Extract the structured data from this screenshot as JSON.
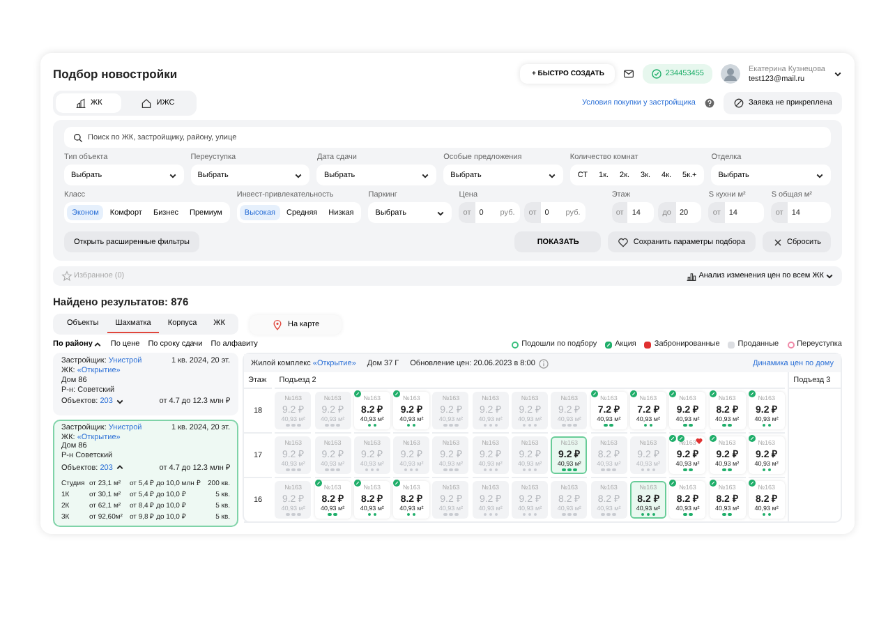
{
  "header": {
    "title": "Подбор новостройки",
    "quick_create": "+ БЫСТРО СОЗДАТЬ",
    "balance": "234453455",
    "user": {
      "name": "Екатерина Кузнецова",
      "email": "test123@mail.ru"
    }
  },
  "object_tabs": [
    {
      "label": "ЖК",
      "kind": "complex",
      "selected": true
    },
    {
      "label": "ИЖС",
      "kind": "house",
      "selected": false
    }
  ],
  "purchase_terms_link": "Условия покупки у застройщика",
  "request_button": "Заявка не прикреплена",
  "filters": {
    "search": {
      "placeholder": "Поиск по ЖК, застройщику, району, улице"
    },
    "primary": [
      {
        "kind": "select",
        "label": "Тип объекта",
        "value": "Выбрать"
      },
      {
        "kind": "select",
        "label": "Переуступка",
        "value": "Выбрать"
      },
      {
        "kind": "select",
        "label": "Дата сдачи",
        "value": "Выбрать"
      },
      {
        "kind": "select",
        "label": "Особые предложения",
        "value": "Выбрать"
      },
      {
        "kind": "chips",
        "label": "Количество комнат",
        "options": [
          {
            "label": "СТ",
            "selected": false
          },
          {
            "label": "1к.",
            "selected": false
          },
          {
            "label": "2к.",
            "selected": false
          },
          {
            "label": "3к.",
            "selected": false
          },
          {
            "label": "4к.",
            "selected": false
          },
          {
            "label": "5к.+",
            "selected": false
          }
        ]
      },
      {
        "kind": "select",
        "label": "Отделка",
        "value": "Выбрать"
      }
    ],
    "secondary": [
      {
        "kind": "chips",
        "label": "Класс",
        "options": [
          {
            "label": "Эконом",
            "selected": true
          },
          {
            "label": "Комфорт",
            "selected": false
          },
          {
            "label": "Бизнес",
            "selected": false
          },
          {
            "label": "Премиум",
            "selected": false
          }
        ]
      },
      {
        "kind": "chips",
        "label": "Инвест-привлекательность",
        "options": [
          {
            "label": "Высокая",
            "selected": true
          },
          {
            "label": "Средняя",
            "selected": false
          },
          {
            "label": "Низкая",
            "selected": false
          }
        ]
      },
      {
        "kind": "select",
        "label": "Паркинг",
        "value": "Выбрать"
      },
      {
        "kind": "range",
        "label": "Цена",
        "inputs": [
          {
            "prefix": "от",
            "value": "0",
            "suffix": "руб."
          },
          {
            "prefix": "от",
            "value": "0",
            "suffix": "руб."
          }
        ]
      },
      {
        "kind": "range",
        "label": "Этаж",
        "inputs": [
          {
            "prefix": "от",
            "value": "14"
          },
          {
            "prefix": "до",
            "value": "20"
          }
        ]
      },
      {
        "kind": "range",
        "label": "S кухни м²",
        "inputs": [
          {
            "prefix": "от",
            "value": "14"
          }
        ]
      },
      {
        "kind": "range",
        "label": "S общая м²",
        "inputs": [
          {
            "prefix": "от",
            "value": "14"
          }
        ]
      }
    ],
    "advanced_button": "Открыть расширенные фильтры",
    "show_button": "ПОКАЗАТЬ",
    "save_button": "Сохранить параметры подбора",
    "reset_button": "Сбросить"
  },
  "favorites": {
    "label": "Избранное (0)",
    "disabled": true
  },
  "price_analysis": "Анализ изменения цен по всем ЖК",
  "results_title": "Найдено результатов: 876",
  "view_tabs": [
    {
      "label": "Объекты",
      "selected": false
    },
    {
      "label": "Шахматка",
      "selected": true
    },
    {
      "label": "Корпуса",
      "selected": false
    },
    {
      "label": "ЖК",
      "selected": false
    }
  ],
  "map_button": "На карте",
  "sort_options": [
    {
      "label": "По району",
      "selected": true
    },
    {
      "label": "По цене",
      "selected": false
    },
    {
      "label": "По сроку сдачи",
      "selected": false
    },
    {
      "label": "По алфавиту",
      "selected": false
    }
  ],
  "legend": [
    {
      "label": "Подошли по подбору",
      "kind": "outline",
      "color": "#3cc07f"
    },
    {
      "label": "Акция",
      "kind": "promo",
      "color": "#1fae6a"
    },
    {
      "label": "Забронированные",
      "kind": "filled",
      "color": "#e03030"
    },
    {
      "label": "Проданные",
      "kind": "filled",
      "color": "#dcdee2"
    },
    {
      "label": "Переуступка",
      "kind": "outline",
      "color": "#f08aa8"
    }
  ],
  "complexes": [
    {
      "developer_label": "Застройщик:",
      "developer": "Унистрой",
      "deadline": "1 кв. 2024, 20 эт.",
      "complex_label": "ЖК:",
      "complex": "«Открытие»",
      "house": "Дом 86",
      "district": "Р-н: Советский",
      "objects_label": "Объектов:",
      "objects": "203",
      "price_range": "от 4.7 до 12.3 млн ₽",
      "expanded": false,
      "selected": false
    },
    {
      "developer_label": "Застройщик:",
      "developer": "Унистрой",
      "deadline": "1 кв. 2024, 20 эт.",
      "complex_label": "ЖК:",
      "complex": "«Открытие»",
      "house": "Дом 86",
      "district": "Р-н Советский",
      "objects_label": "Объектов:",
      "objects": "203",
      "price_range": "от 4.7 до 12.3 млн ₽",
      "expanded": true,
      "selected": true,
      "layouts": [
        {
          "type": "Студия",
          "area": "от 23,1 м²",
          "price": "от 5,4 ₽ до 10,0 млн ₽",
          "count": "200 кв."
        },
        {
          "type": "1К",
          "area": "от 30,1 м²",
          "price": "от 5,4 ₽ до 10,0 ₽",
          "count": "5 кв."
        },
        {
          "type": "2К",
          "area": "от 62,1 м²",
          "price": "от 8,4 ₽ до 10,0 ₽",
          "count": "5 кв."
        },
        {
          "type": "3К",
          "area": "от 92,60м²",
          "price": "от 9,8 ₽ до 10,0 ₽",
          "count": "5 кв."
        }
      ]
    }
  ],
  "chessboard": {
    "complex_label": "Жилой комплекс",
    "complex": "«Открытие»",
    "house": "Дом 37 Г",
    "updated": "Обновление цен: 20.06.2023 в 8:00",
    "dynamics_link": "Динамика цен по дому",
    "floor_header": "Этаж",
    "entrances": [
      "Подъезд 2",
      "Подъезд 3"
    ],
    "floors": [
      {
        "floor": "18",
        "cells": [
          {
            "kind": "sold",
            "number": "№163",
            "price": "9.2 ₽",
            "area": "40,93 м²"
          },
          {
            "kind": "sold",
            "number": "№163",
            "price": "9.2 ₽",
            "area": "40,93 м²"
          },
          {
            "kind": "available",
            "number": "№163",
            "price": "8.2 ₽",
            "area": "40,93 м²",
            "promo": true
          },
          {
            "kind": "available",
            "number": "№163",
            "price": "9.2 ₽",
            "area": "40,93 м²",
            "promo": true
          },
          {
            "kind": "sold",
            "number": "№163",
            "price": "9.2 ₽",
            "area": "40,93 м²"
          },
          {
            "kind": "sold",
            "number": "№163",
            "price": "9.2 ₽",
            "area": "40,93 м²"
          },
          {
            "kind": "sold",
            "number": "№163",
            "price": "9.2 ₽",
            "area": "40,93 м²"
          },
          {
            "kind": "sold",
            "number": "№163",
            "price": "9.2 ₽",
            "area": "40,93 м²"
          },
          {
            "kind": "available",
            "number": "№163",
            "price": "7.2 ₽",
            "area": "40,93 м²",
            "promo": true
          },
          {
            "kind": "available",
            "number": "№163",
            "price": "7.2 ₽",
            "area": "40,93 м²",
            "promo": true
          },
          {
            "kind": "available",
            "number": "№163",
            "price": "9.2 ₽",
            "area": "40,93 м²",
            "promo": true
          },
          {
            "kind": "available",
            "number": "№163",
            "price": "8.2 ₽",
            "area": "40,93 м²",
            "promo": true
          },
          {
            "kind": "available",
            "number": "№163",
            "price": "9.2 ₽",
            "area": "40,93 м²",
            "promo": true
          }
        ]
      },
      {
        "floor": "17",
        "cells": [
          {
            "kind": "sold",
            "number": "№163",
            "price": "9.2 ₽",
            "area": "40,93 м²"
          },
          {
            "kind": "sold",
            "number": "№163",
            "price": "9.2 ₽",
            "area": "40,93 м²"
          },
          {
            "kind": "sold",
            "number": "№163",
            "price": "9.2 ₽",
            "area": "40,93 м²"
          },
          {
            "kind": "sold",
            "number": "№163",
            "price": "9.2 ₽",
            "area": "40,93 м²"
          },
          {
            "kind": "sold",
            "number": "№163",
            "price": "9.2 ₽",
            "area": "40,93 м²"
          },
          {
            "kind": "sold",
            "number": "№163",
            "price": "9.2 ₽",
            "area": "40,93 м²"
          },
          {
            "kind": "sold",
            "number": "№163",
            "price": "9.2 ₽",
            "area": "40,93 м²"
          },
          {
            "kind": "match",
            "number": "№163",
            "price": "9.2 ₽",
            "area": "40,93 м²"
          },
          {
            "kind": "sold",
            "number": "№163",
            "price": "8.2 ₽",
            "area": "40,93 м²"
          },
          {
            "kind": "sold",
            "number": "№163",
            "price": "9.2 ₽",
            "area": "40,93 м²"
          },
          {
            "kind": "available",
            "number": "№163",
            "price": "9.2 ₽",
            "area": "40,93 м²",
            "promo": true,
            "second_badge": true,
            "favorite": true
          },
          {
            "kind": "available",
            "number": "№163",
            "price": "9.2 ₽",
            "area": "40,93 м²",
            "promo": true
          },
          {
            "kind": "available",
            "number": "№163",
            "price": "9.2 ₽",
            "area": "40,93 м²",
            "promo": true
          }
        ]
      },
      {
        "floor": "16",
        "cells": [
          {
            "kind": "sold",
            "number": "№163",
            "price": "9.2 ₽",
            "area": "40,93 м²"
          },
          {
            "kind": "available",
            "number": "№163",
            "price": "8.2 ₽",
            "area": "40,93 м²",
            "promo": true
          },
          {
            "kind": "available",
            "number": "№163",
            "price": "8.2 ₽",
            "area": "40,93 м²",
            "promo": true
          },
          {
            "kind": "available",
            "number": "№163",
            "price": "8.2 ₽",
            "area": "40,93 м²",
            "promo": true
          },
          {
            "kind": "sold",
            "number": "№163",
            "price": "9.2 ₽",
            "area": "40,93 м²"
          },
          {
            "kind": "sold",
            "number": "№163",
            "price": "9.2 ₽",
            "area": "40,93 м²"
          },
          {
            "kind": "sold",
            "number": "№163",
            "price": "9.2 ₽",
            "area": "40,93 м²"
          },
          {
            "kind": "sold",
            "number": "№163",
            "price": "8.2 ₽",
            "area": "40,93 м²"
          },
          {
            "kind": "sold",
            "number": "№163",
            "price": "8.2 ₽",
            "area": "40,93 м²"
          },
          {
            "kind": "match",
            "number": "№163",
            "price": "8.2 ₽",
            "area": "40,93 м²"
          },
          {
            "kind": "available",
            "number": "№163",
            "price": "8.2 ₽",
            "area": "40,93 м²",
            "promo": true
          },
          {
            "kind": "available",
            "number": "№163",
            "price": "8.2 ₽",
            "area": "40,93 м²",
            "promo": true
          },
          {
            "kind": "available",
            "number": "№163",
            "price": "8.2 ₽",
            "area": "40,93 м²",
            "promo": true
          }
        ]
      }
    ]
  }
}
